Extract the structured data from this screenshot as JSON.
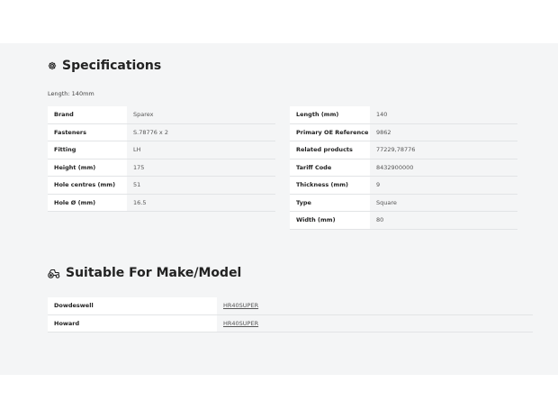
{
  "specifications": {
    "title": "Specifications",
    "icon": "gear-icon",
    "length_note": "Length: 140mm",
    "left": [
      {
        "label": "Brand",
        "value": "Sparex"
      },
      {
        "label": "Fasteners",
        "value": "S.78776 x 2"
      },
      {
        "label": "Fitting",
        "value": "LH"
      },
      {
        "label": "Height (mm)",
        "value": "175"
      },
      {
        "label": "Hole centres (mm)",
        "value": "51"
      },
      {
        "label": "Hole Ø (mm)",
        "value": "16.5"
      }
    ],
    "right": [
      {
        "label": "Length (mm)",
        "value": "140"
      },
      {
        "label": "Primary OE Reference",
        "value": "9862"
      },
      {
        "label": "Related products",
        "value": "77229,78776"
      },
      {
        "label": "Tariff Code",
        "value": "8432900000"
      },
      {
        "label": "Thickness (mm)",
        "value": "9"
      },
      {
        "label": "Type",
        "value": "Square"
      },
      {
        "label": "Width (mm)",
        "value": "80"
      }
    ]
  },
  "suitable": {
    "title": "Suitable For Make/Model",
    "icon": "tractor-icon",
    "rows": [
      {
        "make": "Dowdeswell",
        "model": "HR40SUPER"
      },
      {
        "make": "Howard",
        "model": "HR40SUPER"
      }
    ]
  },
  "colors": {
    "panel_bg": "#f4f5f6",
    "key_bg": "#ffffff",
    "text": "#2a2a2a",
    "muted": "#555555"
  }
}
